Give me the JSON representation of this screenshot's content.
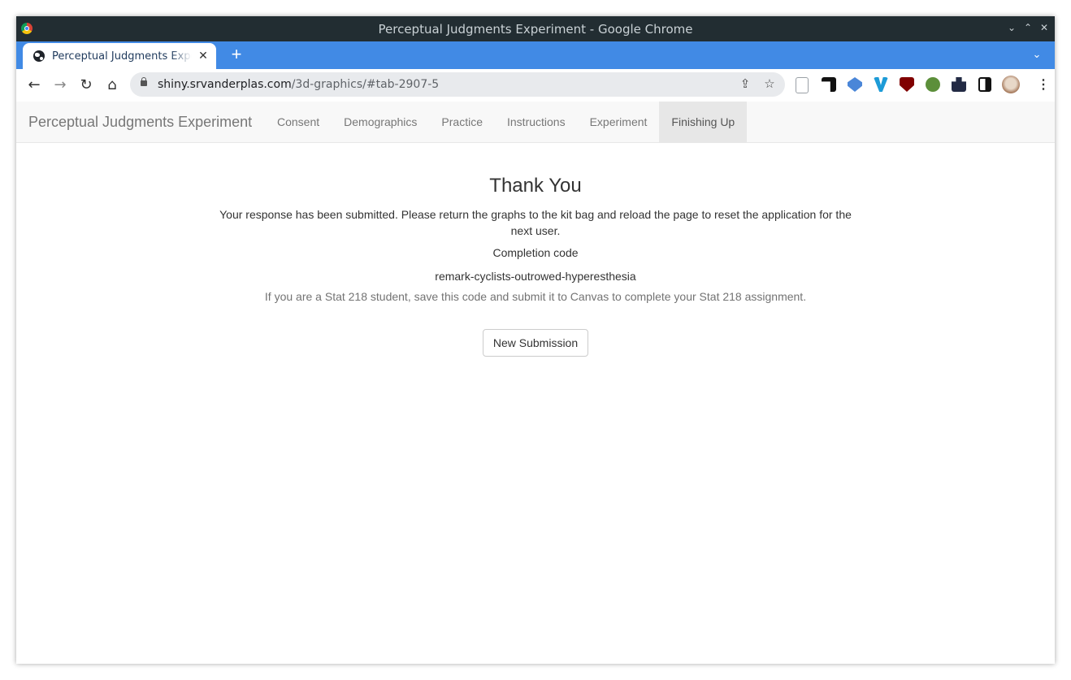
{
  "window": {
    "title": "Perceptual Judgments Experiment - Google Chrome",
    "controls": [
      "⌄",
      "⌃",
      "✕"
    ]
  },
  "tab": {
    "title": "Perceptual Judgments Experiment",
    "close": "✕",
    "new_tab": "+",
    "tab_search": "⌄"
  },
  "toolbar": {
    "back": "←",
    "forward": "→",
    "reload": "↻",
    "home": "⌂",
    "url_host": "shiny.srvanderplas.com",
    "url_path": "/3d-graphics/#tab-2907-5",
    "share": "⇪",
    "bookmark": "☆",
    "menu": "⋮",
    "extensions": [
      "page-icon",
      "notion-icon",
      "graduation-cap-icon",
      "vivaldi-icon",
      "ublock-icon",
      "privacy-badger-icon",
      "puzzle-icon",
      "side-panel-icon",
      "avatar-icon"
    ]
  },
  "navbar": {
    "brand": "Perceptual Judgments Experiment",
    "items": [
      {
        "label": "Consent"
      },
      {
        "label": "Demographics"
      },
      {
        "label": "Practice"
      },
      {
        "label": "Instructions"
      },
      {
        "label": "Experiment"
      },
      {
        "label": "Finishing Up",
        "active": true
      }
    ]
  },
  "main": {
    "heading": "Thank You",
    "message": "Your response has been submitted. Please return the graphs to the kit bag and reload the page to reset the application for the next user.",
    "completion_label": "Completion code",
    "completion_code": "remark-cyclists-outrowed-hyperesthesia",
    "help_text": "If you are a Stat 218 student, save this code and submit it to Canvas to complete your Stat 218 assignment.",
    "button_label": "New Submission"
  },
  "colors": {
    "titlebar": "#222d32",
    "tabstrip": "#418ae5",
    "navbar_bg": "#f8f8f8",
    "active_nav_bg": "#e7e7e7"
  }
}
